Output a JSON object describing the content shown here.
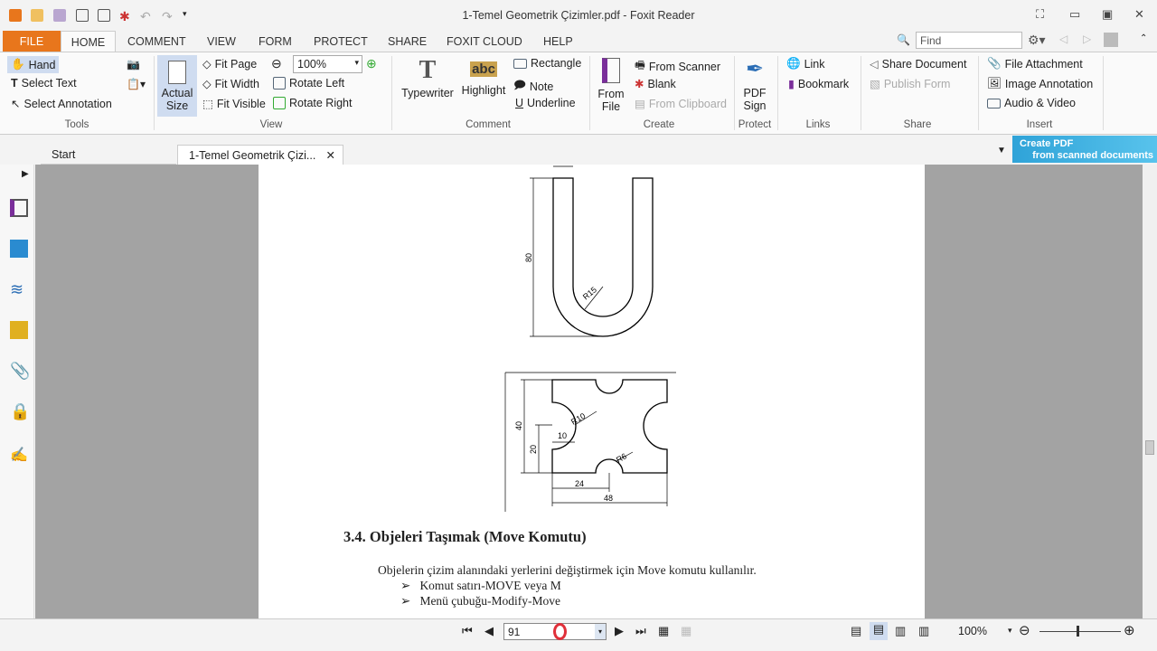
{
  "window": {
    "title": "1-Temel Geometrik Çizimler.pdf - Foxit Reader"
  },
  "ribbon_tabs": [
    "FILE",
    "HOME",
    "COMMENT",
    "VIEW",
    "FORM",
    "PROTECT",
    "SHARE",
    "FOXIT CLOUD",
    "HELP"
  ],
  "find": {
    "placeholder": "Find"
  },
  "tools": {
    "hand": "Hand",
    "select_text": "Select Text",
    "select_annotation": "Select Annotation",
    "group": "Tools"
  },
  "view": {
    "actual_size_1": "Actual",
    "actual_size_2": "Size",
    "fit_page": "Fit Page",
    "fit_width": "Fit Width",
    "fit_visible": "Fit Visible",
    "zoom": "100%",
    "rotate_left": "Rotate Left",
    "rotate_right": "Rotate Right",
    "group": "View"
  },
  "comment": {
    "typewriter": "Typewriter",
    "highlight": "Highlight",
    "abc": "abc",
    "rectangle": "Rectangle",
    "note": "Note",
    "underline": "Underline",
    "group": "Comment"
  },
  "create": {
    "from_file_1": "From",
    "from_file_2": "File",
    "from_scanner": "From Scanner",
    "blank": "Blank",
    "from_clipboard": "From Clipboard",
    "group": "Create"
  },
  "protect": {
    "pdf_sign_1": "PDF",
    "pdf_sign_2": "Sign",
    "group": "Protect"
  },
  "links": {
    "link": "Link",
    "bookmark": "Bookmark",
    "group": "Links"
  },
  "share": {
    "share_document": "Share Document",
    "publish_form": "Publish Form",
    "group": "Share"
  },
  "insert": {
    "file_attachment": "File Attachment",
    "image_annotation": "Image Annotation",
    "audio_video": "Audio & Video",
    "group": "Insert"
  },
  "doc_tabs": {
    "start": "Start",
    "current": "1-Temel Geometrik Çizi..."
  },
  "promo": {
    "line1": "Create PDF",
    "line2": "from scanned documents"
  },
  "drawing1": {
    "dim_height": "80",
    "radius": "R15"
  },
  "drawing2": {
    "dim_40": "40",
    "dim_20": "20",
    "dim_10": "10",
    "r10": "R10",
    "r6": "R6",
    "dim_24": "24",
    "dim_48": "48"
  },
  "content": {
    "heading": "3.4. Objeleri Taşımak (Move Komutu)",
    "paragraph": "Objelerin çizim alanındaki yerlerini değiştirmek için Move komutu kullanılır.",
    "bullets": [
      "Komut satırı-MOVE veya M",
      "Menü çubuğu-Modify-Move"
    ]
  },
  "status": {
    "page_input": "91",
    "zoom": "100%"
  }
}
